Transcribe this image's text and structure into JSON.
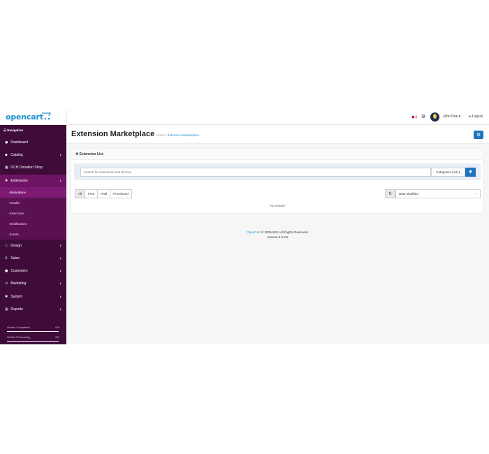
{
  "header": {
    "logo_text": "opencart",
    "user_name": "John Doe ▾",
    "logout_label": "⇥ Logout"
  },
  "sidebar": {
    "nav_title": "☰ Navigation",
    "items": [
      {
        "icon": "◕",
        "label": "Dashboard",
        "chevron": ""
      },
      {
        "icon": "◆",
        "label": "Catalog",
        "chevron": "›"
      },
      {
        "icon": "▦",
        "label": "OCH Donation Shop",
        "chevron": ""
      },
      {
        "icon": "✚",
        "label": "Extensions",
        "chevron": "›"
      }
    ],
    "sub_items": [
      "› Marketplace",
      "› Installer",
      "› Extensions",
      "› Modifications",
      "› Events"
    ],
    "items_after": [
      {
        "icon": "▭",
        "label": "Design",
        "chevron": "›"
      },
      {
        "icon": "⊻",
        "label": "Sales",
        "chevron": "›"
      },
      {
        "icon": "●",
        "label": "Customers",
        "chevron": "›"
      },
      {
        "icon": "⋖",
        "label": "Marketing",
        "chevron": "›"
      },
      {
        "icon": "✱",
        "label": "System",
        "chevron": "›"
      },
      {
        "icon": "▥",
        "label": "Reports",
        "chevron": "›"
      }
    ],
    "progress": [
      {
        "label": "Orders Completed",
        "value": "0%",
        "fraction": 0
      },
      {
        "label": "Orders Processing",
        "value": "0%",
        "fraction": 0
      }
    ]
  },
  "page": {
    "title": "Extension Marketplace",
    "breadcrumb_home": "Home",
    "breadcrumb_sep": " / ",
    "breadcrumb_current": "Extension Marketplace",
    "panel_title": "✚ Extension List",
    "search_placeholder": "Search for extensions and themes",
    "category_button": "Categories (All) ▾",
    "tabs": [
      "All",
      "Free",
      "Paid",
      "Purchased"
    ],
    "sort_value": "Date Modified",
    "no_results": "No results!"
  },
  "footer": {
    "brand": "OpenCart",
    "copyright": " © 2009-2024 All Rights Reserved.",
    "version": "Version 3.0.3.8"
  },
  "colors": {
    "sidebar": "#3f0c3a",
    "accent": "#1e73be",
    "link": "#1e91cf"
  }
}
